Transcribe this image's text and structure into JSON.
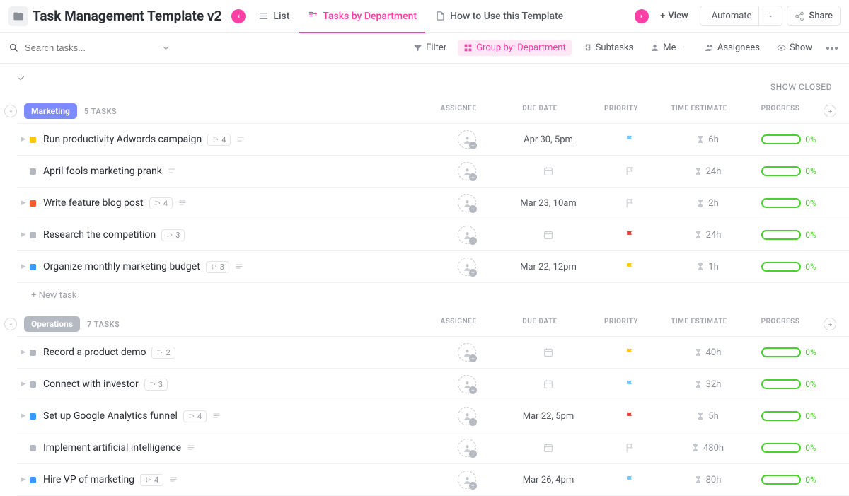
{
  "header": {
    "title": "Task Management Template v2",
    "tabs": {
      "list": "List",
      "dept": "Tasks by Department",
      "howto": "How to Use this Template"
    },
    "add_view": "View",
    "automate": "Automate",
    "share": "Share"
  },
  "toolbar": {
    "search_placeholder": "Search tasks...",
    "filter": "Filter",
    "group_by": "Group by: Department",
    "subtasks": "Subtasks",
    "me": "Me",
    "assignees": "Assignees",
    "show": "Show"
  },
  "show_closed": "SHOW CLOSED",
  "columns": {
    "assignee": "ASSIGNEE",
    "due": "DUE DATE",
    "priority": "PRIORITY",
    "estimate": "TIME ESTIMATE",
    "progress": "PROGRESS"
  },
  "new_task": "+ New task",
  "groups": [
    {
      "name": "Marketing",
      "badge_class": "badge-marketing",
      "count": "5 TASKS",
      "tasks": [
        {
          "caret": true,
          "status": "#ffc800",
          "name": "Run productivity Adwords campaign",
          "sub": "4",
          "desc": true,
          "due": "Apr 30, 5pm",
          "flag": "blue",
          "estimate": "6h",
          "progress": "0%"
        },
        {
          "caret": false,
          "status": "#b5b9c2",
          "name": "April fools marketing prank",
          "sub": "",
          "desc": true,
          "due": "",
          "flag": "gray",
          "estimate": "24h",
          "progress": "0%"
        },
        {
          "caret": true,
          "status": "#ff5b22",
          "name": "Write feature blog post",
          "sub": "4",
          "desc": true,
          "due": "Mar 23, 10am",
          "flag": "gray",
          "estimate": "2h",
          "progress": "0%"
        },
        {
          "caret": true,
          "status": "#b5b9c2",
          "name": "Research the competition",
          "sub": "3",
          "desc": false,
          "due": "",
          "flag": "red",
          "estimate": "24h",
          "progress": "0%"
        },
        {
          "caret": true,
          "status": "#3a9bff",
          "name": "Organize monthly marketing budget",
          "sub": "3",
          "desc": true,
          "due": "Mar 22, 12pm",
          "flag": "yellow",
          "estimate": "1h",
          "progress": "0%"
        }
      ]
    },
    {
      "name": "Operations",
      "badge_class": "badge-operations",
      "count": "7 TASKS",
      "tasks": [
        {
          "caret": true,
          "status": "#b5b9c2",
          "name": "Record a product demo",
          "sub": "2",
          "desc": false,
          "due": "",
          "flag": "yellow",
          "estimate": "40h",
          "progress": "0%"
        },
        {
          "caret": true,
          "status": "#b5b9c2",
          "name": "Connect with investor",
          "sub": "3",
          "desc": false,
          "due": "",
          "flag": "blue",
          "estimate": "32h",
          "progress": "0%"
        },
        {
          "caret": true,
          "status": "#3a9bff",
          "name": "Set up Google Analytics funnel",
          "sub": "4",
          "desc": true,
          "due": "Mar 22, 5pm",
          "flag": "red",
          "estimate": "5h",
          "progress": "0%"
        },
        {
          "caret": false,
          "status": "#b5b9c2",
          "name": "Implement artificial intelligence",
          "sub": "",
          "desc": true,
          "due": "",
          "flag": "gray",
          "estimate": "480h",
          "progress": "0%"
        },
        {
          "caret": true,
          "status": "#3a9bff",
          "name": "Hire VP of marketing",
          "sub": "4",
          "desc": true,
          "due": "Mar 26, 4pm",
          "flag": "blue",
          "estimate": "80h",
          "progress": "0%"
        }
      ]
    }
  ]
}
